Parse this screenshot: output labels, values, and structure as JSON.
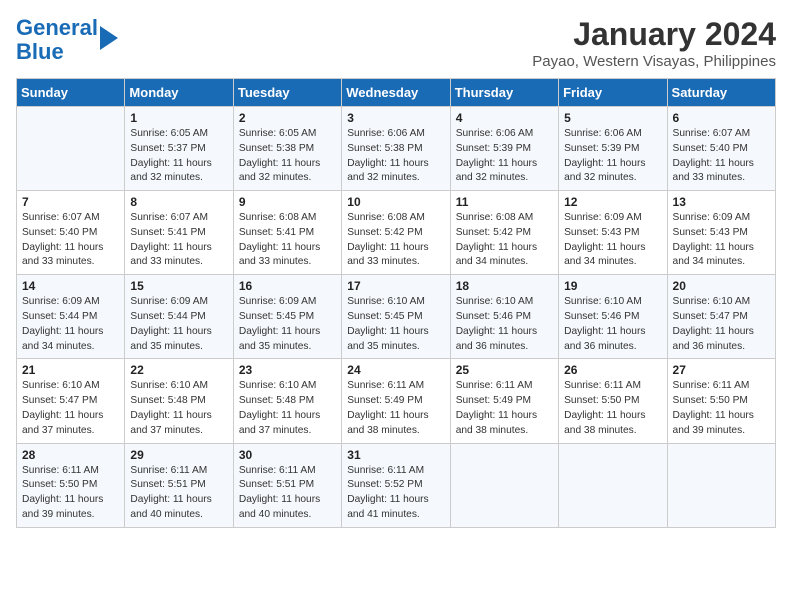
{
  "header": {
    "logo_line1": "General",
    "logo_line2": "Blue",
    "month": "January 2024",
    "location": "Payao, Western Visayas, Philippines"
  },
  "days_of_week": [
    "Sunday",
    "Monday",
    "Tuesday",
    "Wednesday",
    "Thursday",
    "Friday",
    "Saturday"
  ],
  "weeks": [
    [
      {
        "day": "",
        "info": ""
      },
      {
        "day": "1",
        "info": "Sunrise: 6:05 AM\nSunset: 5:37 PM\nDaylight: 11 hours\nand 32 minutes."
      },
      {
        "day": "2",
        "info": "Sunrise: 6:05 AM\nSunset: 5:38 PM\nDaylight: 11 hours\nand 32 minutes."
      },
      {
        "day": "3",
        "info": "Sunrise: 6:06 AM\nSunset: 5:38 PM\nDaylight: 11 hours\nand 32 minutes."
      },
      {
        "day": "4",
        "info": "Sunrise: 6:06 AM\nSunset: 5:39 PM\nDaylight: 11 hours\nand 32 minutes."
      },
      {
        "day": "5",
        "info": "Sunrise: 6:06 AM\nSunset: 5:39 PM\nDaylight: 11 hours\nand 32 minutes."
      },
      {
        "day": "6",
        "info": "Sunrise: 6:07 AM\nSunset: 5:40 PM\nDaylight: 11 hours\nand 33 minutes."
      }
    ],
    [
      {
        "day": "7",
        "info": "Sunrise: 6:07 AM\nSunset: 5:40 PM\nDaylight: 11 hours\nand 33 minutes."
      },
      {
        "day": "8",
        "info": "Sunrise: 6:07 AM\nSunset: 5:41 PM\nDaylight: 11 hours\nand 33 minutes."
      },
      {
        "day": "9",
        "info": "Sunrise: 6:08 AM\nSunset: 5:41 PM\nDaylight: 11 hours\nand 33 minutes."
      },
      {
        "day": "10",
        "info": "Sunrise: 6:08 AM\nSunset: 5:42 PM\nDaylight: 11 hours\nand 33 minutes."
      },
      {
        "day": "11",
        "info": "Sunrise: 6:08 AM\nSunset: 5:42 PM\nDaylight: 11 hours\nand 34 minutes."
      },
      {
        "day": "12",
        "info": "Sunrise: 6:09 AM\nSunset: 5:43 PM\nDaylight: 11 hours\nand 34 minutes."
      },
      {
        "day": "13",
        "info": "Sunrise: 6:09 AM\nSunset: 5:43 PM\nDaylight: 11 hours\nand 34 minutes."
      }
    ],
    [
      {
        "day": "14",
        "info": "Sunrise: 6:09 AM\nSunset: 5:44 PM\nDaylight: 11 hours\nand 34 minutes."
      },
      {
        "day": "15",
        "info": "Sunrise: 6:09 AM\nSunset: 5:44 PM\nDaylight: 11 hours\nand 35 minutes."
      },
      {
        "day": "16",
        "info": "Sunrise: 6:09 AM\nSunset: 5:45 PM\nDaylight: 11 hours\nand 35 minutes."
      },
      {
        "day": "17",
        "info": "Sunrise: 6:10 AM\nSunset: 5:45 PM\nDaylight: 11 hours\nand 35 minutes."
      },
      {
        "day": "18",
        "info": "Sunrise: 6:10 AM\nSunset: 5:46 PM\nDaylight: 11 hours\nand 36 minutes."
      },
      {
        "day": "19",
        "info": "Sunrise: 6:10 AM\nSunset: 5:46 PM\nDaylight: 11 hours\nand 36 minutes."
      },
      {
        "day": "20",
        "info": "Sunrise: 6:10 AM\nSunset: 5:47 PM\nDaylight: 11 hours\nand 36 minutes."
      }
    ],
    [
      {
        "day": "21",
        "info": "Sunrise: 6:10 AM\nSunset: 5:47 PM\nDaylight: 11 hours\nand 37 minutes."
      },
      {
        "day": "22",
        "info": "Sunrise: 6:10 AM\nSunset: 5:48 PM\nDaylight: 11 hours\nand 37 minutes."
      },
      {
        "day": "23",
        "info": "Sunrise: 6:10 AM\nSunset: 5:48 PM\nDaylight: 11 hours\nand 37 minutes."
      },
      {
        "day": "24",
        "info": "Sunrise: 6:11 AM\nSunset: 5:49 PM\nDaylight: 11 hours\nand 38 minutes."
      },
      {
        "day": "25",
        "info": "Sunrise: 6:11 AM\nSunset: 5:49 PM\nDaylight: 11 hours\nand 38 minutes."
      },
      {
        "day": "26",
        "info": "Sunrise: 6:11 AM\nSunset: 5:50 PM\nDaylight: 11 hours\nand 38 minutes."
      },
      {
        "day": "27",
        "info": "Sunrise: 6:11 AM\nSunset: 5:50 PM\nDaylight: 11 hours\nand 39 minutes."
      }
    ],
    [
      {
        "day": "28",
        "info": "Sunrise: 6:11 AM\nSunset: 5:50 PM\nDaylight: 11 hours\nand 39 minutes."
      },
      {
        "day": "29",
        "info": "Sunrise: 6:11 AM\nSunset: 5:51 PM\nDaylight: 11 hours\nand 40 minutes."
      },
      {
        "day": "30",
        "info": "Sunrise: 6:11 AM\nSunset: 5:51 PM\nDaylight: 11 hours\nand 40 minutes."
      },
      {
        "day": "31",
        "info": "Sunrise: 6:11 AM\nSunset: 5:52 PM\nDaylight: 11 hours\nand 41 minutes."
      },
      {
        "day": "",
        "info": ""
      },
      {
        "day": "",
        "info": ""
      },
      {
        "day": "",
        "info": ""
      }
    ]
  ]
}
